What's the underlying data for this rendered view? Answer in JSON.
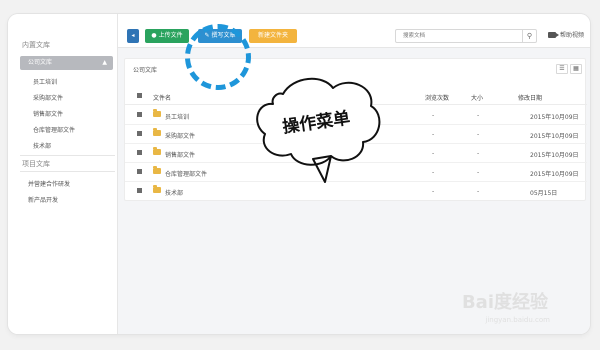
{
  "sidebar": {
    "section1": "内置文库",
    "selected": "公司文库",
    "items": [
      "员工培训",
      "采购部文件",
      "销售部文件",
      "仓库管理部文件",
      "技术部"
    ],
    "section2": "项目文库",
    "projects": [
      "并营建合作研发",
      "新产品开发"
    ]
  },
  "toolbar": {
    "back_icon": "◂",
    "upload_label": "上传文件",
    "write_label": "撰写文章",
    "folder_label": "新建文件夹",
    "search_placeholder": "搜索文档",
    "help_label": "帮助视频"
  },
  "panel": {
    "title": "公司文库",
    "columns": {
      "name": "文件名",
      "views": "浏览次数",
      "size": "大小",
      "modified": "修改日期"
    },
    "rows": [
      {
        "name": "员工培训",
        "views": "-",
        "size": "-",
        "modified": "2015年10月09日"
      },
      {
        "name": "采购部文件",
        "views": "-",
        "size": "-",
        "modified": "2015年10月09日"
      },
      {
        "name": "销售部文件",
        "views": "-",
        "size": "-",
        "modified": "2015年10月09日"
      },
      {
        "name": "仓库管理部文件",
        "views": "-",
        "size": "-",
        "modified": "2015年10月09日"
      },
      {
        "name": "技术部",
        "views": "-",
        "size": "-",
        "modified": "05月15日"
      }
    ]
  },
  "annotation": {
    "bubble_text": "操作菜单"
  },
  "watermark": {
    "brand": "Bai度经验",
    "url": "jingyan.baidu.com"
  },
  "colors": {
    "upload": "#2aa35e",
    "write": "#2d8fd0",
    "folder": "#f3b43e",
    "highlight": "#1e96da"
  }
}
